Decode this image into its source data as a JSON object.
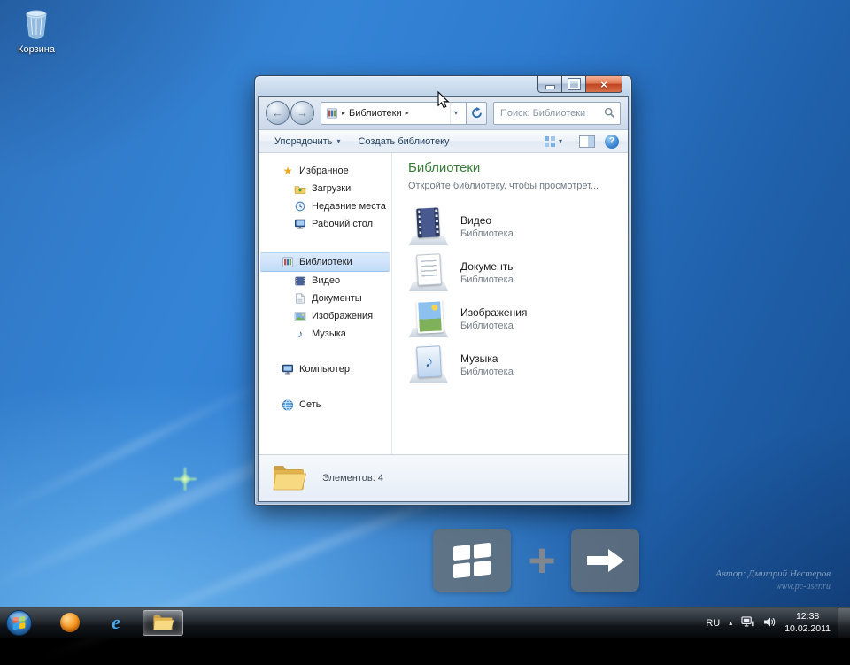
{
  "desktop": {
    "recycle_bin_label": "Корзина",
    "watermark_line1": "Автор: Дмитрий Нестеров",
    "watermark_line2": "www.pc-user.ru"
  },
  "explorer": {
    "breadcrumb": "Библиотеки",
    "search_placeholder": "Поиск: Библиотеки",
    "toolbar": {
      "organize": "Упорядочить",
      "new_library": "Создать библиотеку"
    },
    "nav": {
      "favorites_label": "Избранное",
      "favorites": [
        {
          "label": "Загрузки"
        },
        {
          "label": "Недавние места"
        },
        {
          "label": "Рабочий стол"
        }
      ],
      "libraries_label": "Библиотеки",
      "libraries": [
        {
          "label": "Видео"
        },
        {
          "label": "Документы"
        },
        {
          "label": "Изображения"
        },
        {
          "label": "Музыка"
        }
      ],
      "computer_label": "Компьютер",
      "network_label": "Сеть"
    },
    "content": {
      "title": "Библиотеки",
      "subtitle": "Откройте библиотеку, чтобы просмотрет...",
      "items": [
        {
          "name": "Видео",
          "kind": "Библиотека"
        },
        {
          "name": "Документы",
          "kind": "Библиотека"
        },
        {
          "name": "Изображения",
          "kind": "Библиотека"
        },
        {
          "name": "Музыка",
          "kind": "Библиотека"
        }
      ]
    },
    "status_text": "Элементов: 4"
  },
  "overlay_hint": {
    "plus": "+"
  },
  "taskbar": {
    "language": "RU",
    "time": "12:38",
    "date": "10.02.2011"
  },
  "icons": {
    "star": "★",
    "music_note": "♪",
    "crumb_sep": "▸",
    "dropdown": "▾",
    "back_arrow": "←",
    "forward_arrow": "→",
    "close": "×",
    "help": "?",
    "tray_expand": "▴",
    "ie": "e"
  }
}
